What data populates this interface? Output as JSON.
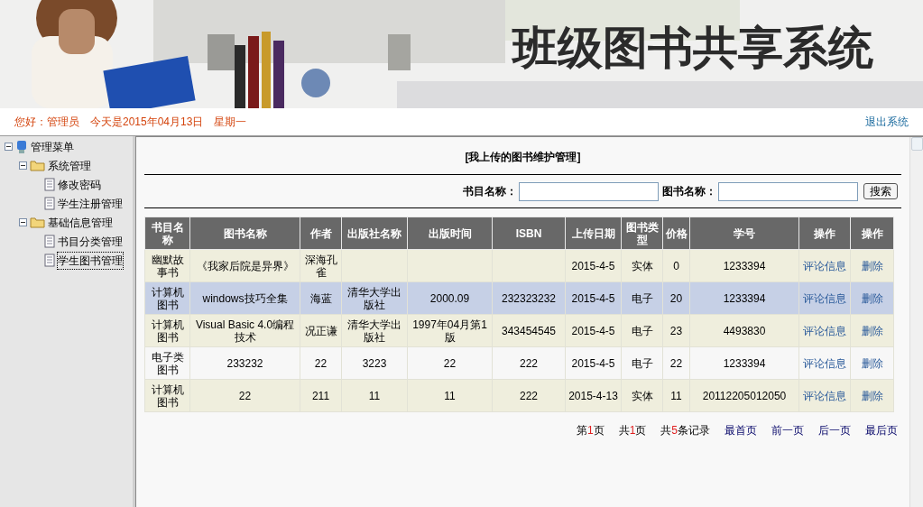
{
  "banner": {
    "title": "班级图书共享系统"
  },
  "top_bar": {
    "greeting": "您好：管理员",
    "date": "今天是2015年04月13日",
    "weekday": "星期一",
    "logout": "退出系统"
  },
  "sidebar": {
    "tree": [
      {
        "label": "管理菜单",
        "kind": "root",
        "expanded": true,
        "selected": false,
        "children": [
          {
            "label": "系统管理",
            "kind": "folder",
            "expanded": true,
            "selected": false,
            "children": [
              {
                "label": "修改密码",
                "kind": "page",
                "selected": false
              },
              {
                "label": "学生注册管理",
                "kind": "page",
                "selected": false
              }
            ]
          },
          {
            "label": "基础信息管理",
            "kind": "folder",
            "expanded": true,
            "selected": false,
            "children": [
              {
                "label": "书目分类管理",
                "kind": "page",
                "selected": false
              },
              {
                "label": "学生图书管理",
                "kind": "page",
                "selected": true
              }
            ]
          }
        ]
      }
    ]
  },
  "main": {
    "title": "[我上传的图书维护管理]",
    "search": {
      "fields": [
        {
          "label": "书目名称："
        },
        {
          "label": "图书名称："
        }
      ],
      "button": "搜索"
    },
    "table": {
      "columns": [
        "书目名称",
        "图书名称",
        "作者",
        "出版社名称",
        "出版时间",
        "ISBN",
        "上传日期",
        "图书类型",
        "价格",
        "学号",
        "操作",
        "操作"
      ],
      "rows": [
        {
          "selected": false,
          "cells": [
            "幽默故事书",
            "《我家后院是异界》",
            "深海孔雀",
            "",
            "",
            "",
            "2015-4-5",
            "实体",
            "0",
            "1233394"
          ],
          "actions": [
            "评论信息",
            "删除"
          ]
        },
        {
          "selected": true,
          "cells": [
            "计算机图书",
            "windows技巧全集",
            "海蓝",
            "清华大学出版社",
            "2000.09",
            "232323232",
            "2015-4-5",
            "电子",
            "20",
            "1233394"
          ],
          "actions": [
            "评论信息",
            "删除"
          ]
        },
        {
          "selected": false,
          "cells": [
            "计算机图书",
            "Visual Basic 4.0编程技术",
            "况正谦",
            "清华大学出版社",
            "1997年04月第1版",
            "343454545",
            "2015-4-5",
            "电子",
            "23",
            "4493830"
          ],
          "actions": [
            "评论信息",
            "删除"
          ]
        },
        {
          "selected": false,
          "cells": [
            "电子类图书",
            "233232",
            "22",
            "3223",
            "22",
            "222",
            "2015-4-5",
            "电子",
            "22",
            "1233394"
          ],
          "actions": [
            "评论信息",
            "删除"
          ]
        },
        {
          "selected": false,
          "cells": [
            "计算机图书",
            "22",
            "211",
            "11",
            "11",
            "222",
            "2015-4-13",
            "实体",
            "11",
            "20112205012050"
          ],
          "actions": [
            "评论信息",
            "删除"
          ]
        }
      ]
    },
    "pager": {
      "info": [
        {
          "prefix": "第",
          "number": "1",
          "suffix": "页"
        },
        {
          "prefix": "共",
          "number": "1",
          "suffix": "页"
        },
        {
          "prefix": "共",
          "number": "5",
          "suffix": "条记录"
        }
      ],
      "links": [
        "最首页",
        "前一页",
        "后一页",
        "最后页"
      ]
    }
  }
}
